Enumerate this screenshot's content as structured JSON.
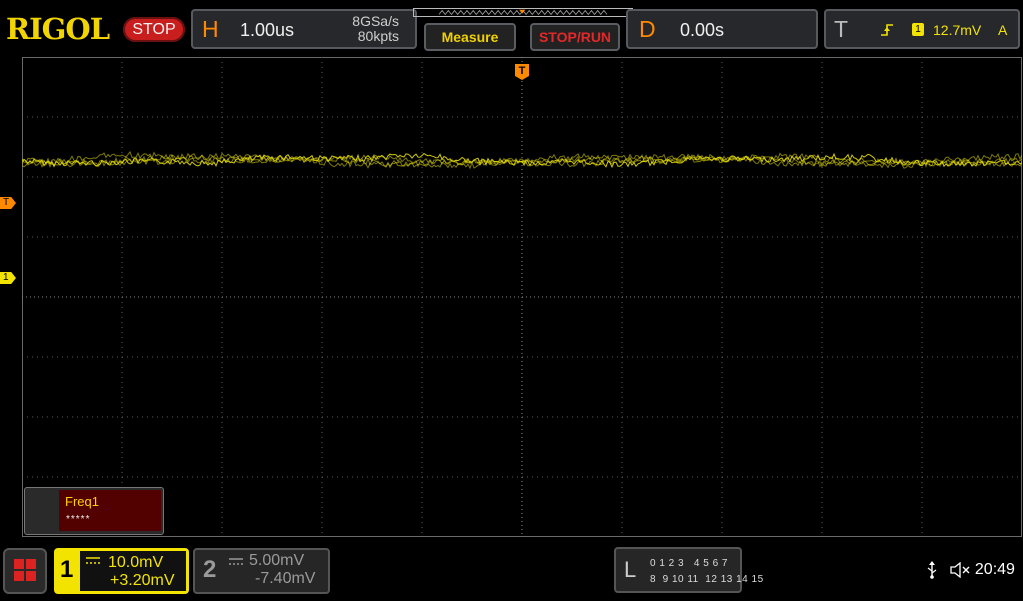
{
  "brand": "RIGOL",
  "run_state": "STOP",
  "horizontal": {
    "letter": "H",
    "timebase": "1.00us",
    "sample_rate": "8GSa/s",
    "memory_depth": "80kpts"
  },
  "buttons": {
    "measure": "Measure",
    "stop_run": "STOP/RUN"
  },
  "delay": {
    "letter": "D",
    "value": "0.00s"
  },
  "trigger": {
    "letter": "T",
    "source": "1",
    "level": "12.7mV",
    "mode": "A"
  },
  "markers": {
    "trigger_level": "T",
    "channel1": "1",
    "trigger_position": "T"
  },
  "measurement": {
    "name": "Freq1",
    "value": "*****"
  },
  "channel1": {
    "number": "1",
    "scale": "10.0mV",
    "offset": "+3.20mV",
    "color": "#f2e300"
  },
  "channel2": {
    "number": "2",
    "scale": "5.00mV",
    "offset": "-7.40mV",
    "color": "#9a9a9a"
  },
  "logic": {
    "letter": "L",
    "row1": "0 1 2 3   4 5 6 7",
    "row2": "8  9 10 11  12 13 14 15"
  },
  "clock": "20:49",
  "colors": {
    "accent": "#ff8a00",
    "brand": "#f2d400",
    "trace": "#e8df00",
    "stop": "#c81e1e"
  }
}
